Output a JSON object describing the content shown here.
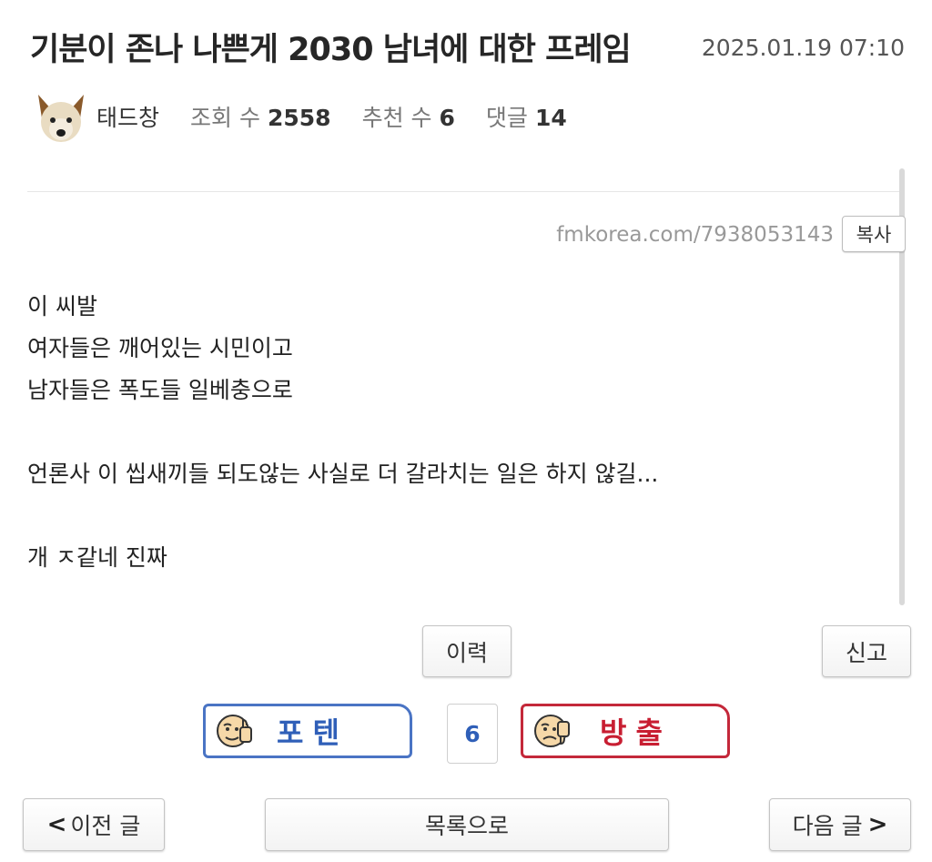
{
  "post": {
    "title": "기분이 존나 나쁜게 2030 남녀에 대한 프레임",
    "date": "2025.01.19 07:10",
    "author": "태드창",
    "views_label": "조회 수",
    "views": "2558",
    "recommend_label": "추천 수",
    "recommend": "6",
    "comments_label": "댓글",
    "comments": "14",
    "url": "fmkorea.com/7938053143",
    "copy_label": "복사",
    "body": {
      "line1": "이 씨발",
      "line2": "여자들은 깨어있는 시민이고",
      "line3": "남자들은 폭도들 일베충으로",
      "line4": "언론사 이 씹새끼들 되도않는 사실로 더 갈라치는 일은 하지 않길...",
      "line5": "개 ㅈ같네 진짜"
    }
  },
  "actions": {
    "history_label": "이력",
    "report_label": "신고"
  },
  "vote": {
    "up_label": "포텐",
    "count": "6",
    "down_label": "방출",
    "up_color": "#4a74c4",
    "down_color": "#c4283a"
  },
  "nav": {
    "prev_arrow": "<",
    "prev_label": "이전 글",
    "list_label": "목록으로",
    "next_label": "다음 글",
    "next_arrow": ">"
  },
  "icons": {
    "avatar": "dog-face-icon",
    "vote_up_face": "thumbs-up-face-icon",
    "vote_down_face": "thumbs-down-face-icon"
  }
}
